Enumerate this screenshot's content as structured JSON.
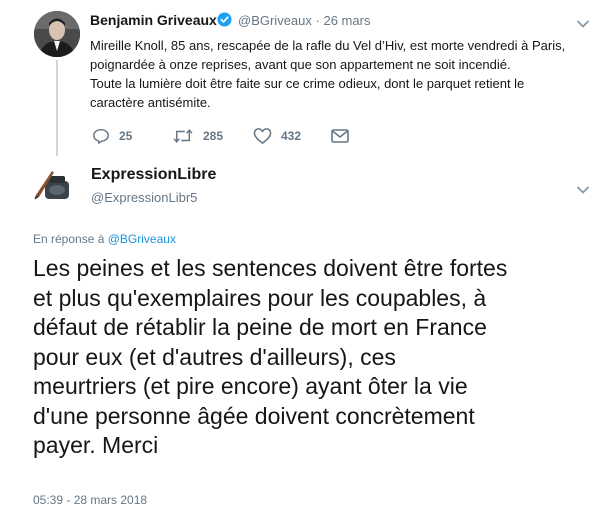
{
  "parent_tweet": {
    "author_name": "Benjamin Griveaux",
    "handle": "@BGriveaux",
    "date": "26 mars",
    "text_line1": "Mireille Knoll, 85 ans, rescapée de la rafle du Vel d’Hiv, est morte vendredi  à Paris,",
    "text_line2": "poignardée à onze reprises, avant que son appartement ne soit incendié.",
    "text_line3": "Toute la lumière doit être faite sur ce crime odieux, dont le parquet retient le",
    "text_line4": "caractère antisémite.",
    "replies": "25",
    "retweets": "285",
    "likes": "432",
    "icons": [
      "reply-icon",
      "retweet-icon",
      "like-icon",
      "dm-icon",
      "verified-icon",
      "chevron-down-icon"
    ],
    "verified_color": "#1da1f2"
  },
  "reply_tweet": {
    "author_name": "ExpressionLibre",
    "handle": "@ExpressionLibr5",
    "in_reply_prefix": "En réponse à",
    "in_reply_handle": "@BGriveaux",
    "text": "Les peines et les sentences doivent être fortes\net plus qu'exemplaires  pour les coupables, à\ndéfaut de rétablir la peine de mort en France\npour  eux (et d'autres d'ailleurs), ces\nmeurtriers (et pire encore) ayant  ôter la vie\nd'une personne âgée doivent concrètement\npayer. Merci",
    "timestamp": "05:39 - 28 mars 2018",
    "link_color": "#1b95e0"
  }
}
